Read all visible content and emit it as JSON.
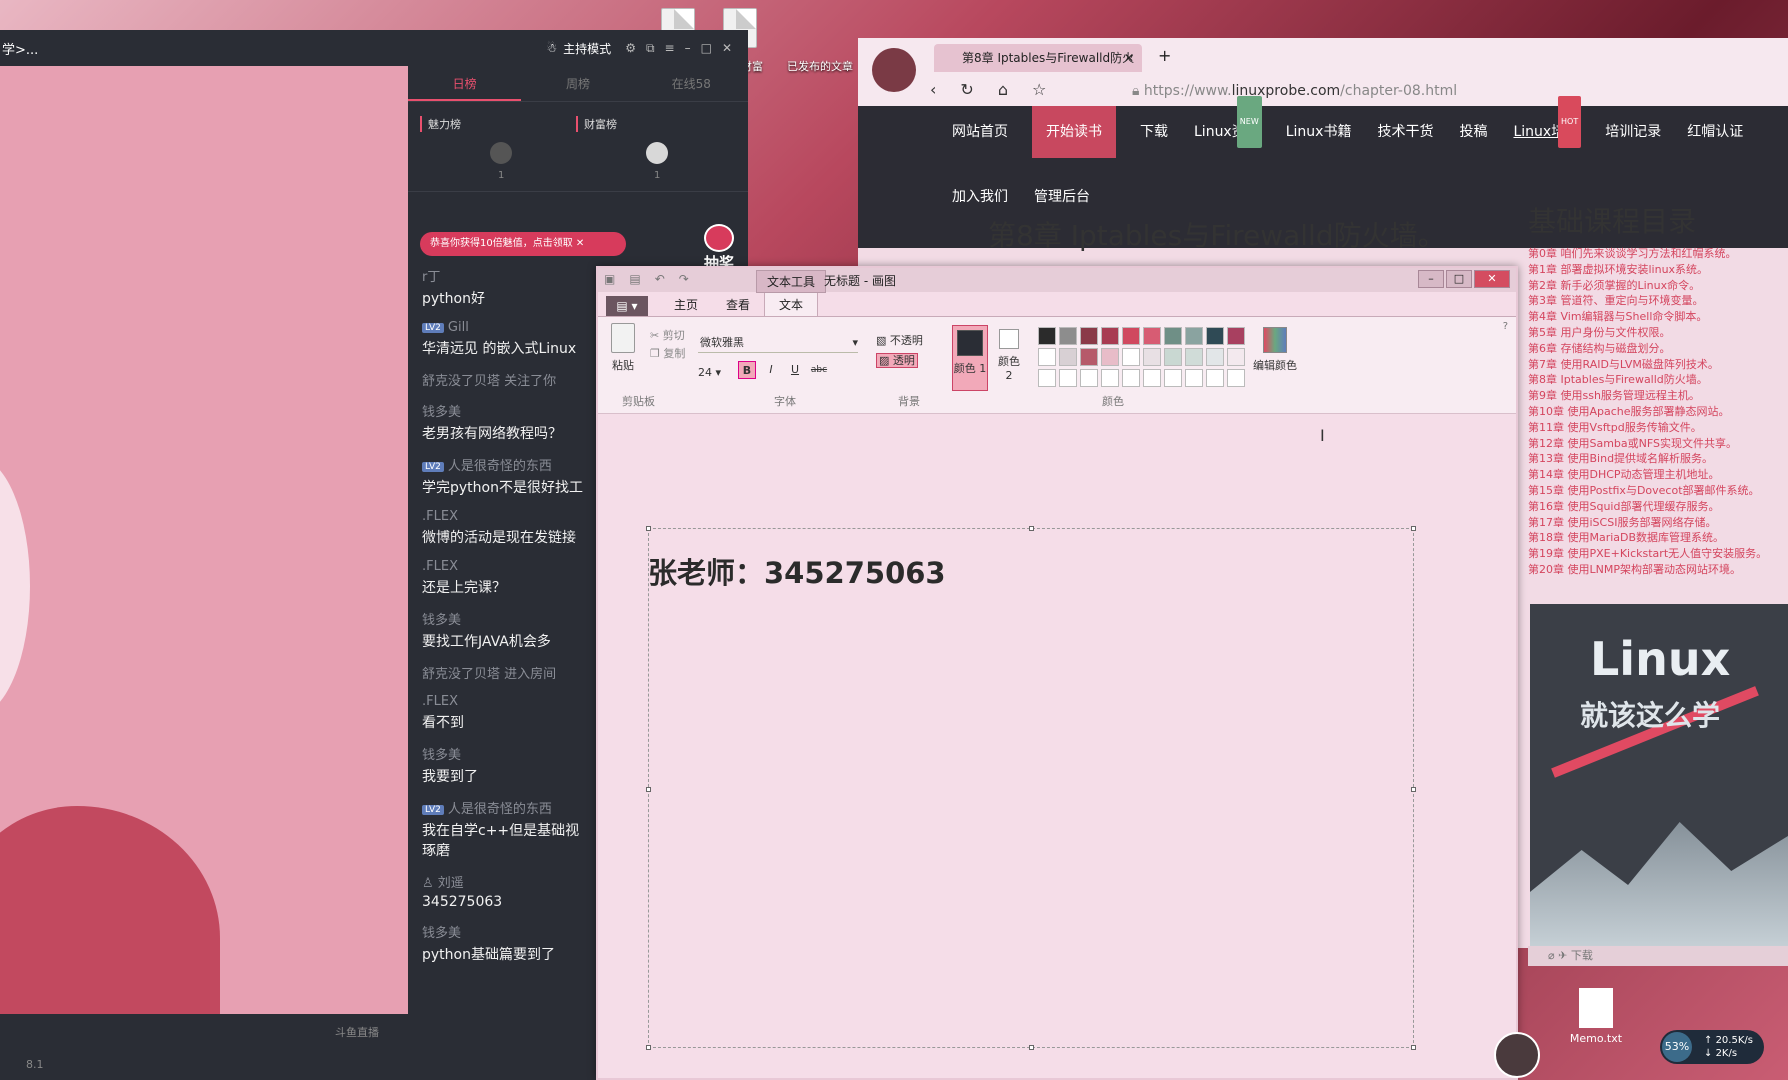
{
  "desktop": {
    "icons_top": [
      "财富",
      "已发布的文章"
    ],
    "memo_label": "Memo.txt"
  },
  "live": {
    "breadcrumb": "学>...",
    "mode_label": "主持模式",
    "tabs": [
      "日榜",
      "周榜",
      "在线58"
    ],
    "rank_charm": "魅力榜",
    "rank_wealth": "财富榜",
    "rank_count_1": "1",
    "rank_count_2": "1",
    "gift_banner": "恭喜你获得10倍魅值，点击领取",
    "lottery": "抽奖",
    "footer_fps": "8.1",
    "footer_tag": "斗鱼直播",
    "messages": [
      {
        "user": "r丁",
        "text": "python好",
        "lv": ""
      },
      {
        "user": "Gill",
        "text": "华清远见 的嵌入式Linux",
        "lv": "LV2"
      },
      {
        "sys": "舒克没了贝塔 关注了你"
      },
      {
        "user": "钱多美",
        "text": "老男孩有网络教程吗？",
        "lv": ""
      },
      {
        "user": "人是很奇怪的东西",
        "text": "学完python不是很好找工",
        "lv": "LV2"
      },
      {
        "user": ".FLEX",
        "text": "微博的活动是现在发链接",
        "lv": ""
      },
      {
        "user": ".FLEX",
        "text": "还是上完课？",
        "lv": ""
      },
      {
        "user": "钱多美",
        "text": "要找工作JAVA机会多",
        "lv": ""
      },
      {
        "sys": "舒克没了贝塔 进入房间"
      },
      {
        "user": ".FLEX",
        "text": "看不到",
        "lv": ""
      },
      {
        "user": "钱多美",
        "text": "我要到了",
        "lv": ""
      },
      {
        "user": "人是很奇怪的东西",
        "text": "我在自学c++但是基础视",
        "text2": "琢磨",
        "lv": "LV2"
      },
      {
        "user": "刘遥",
        "text": "345275063",
        "lv": ""
      },
      {
        "user": "钱多美",
        "text": "python基础篇要到了",
        "lv": ""
      }
    ]
  },
  "browser": {
    "tab_title": "第8章 Iptables与Firewalld防火",
    "url_prefix": "https://www.",
    "url_domain": "linuxprobe.com",
    "url_path": "/chapter-08.html",
    "menu_row1": [
      "网站首页",
      "开始读书",
      "下载",
      "Linux资讯",
      "Linux书籍",
      "技术干货",
      "投稿",
      "Linux培训",
      "培训记录",
      "红帽认证"
    ],
    "menu_row2": [
      "加入我们",
      "管理后台"
    ],
    "badge_new": "NEW",
    "badge_hot": "HOT",
    "page_title": "第8章 Iptables与Firewalld防火墙。",
    "toc_title": "基础课程目录",
    "toc": [
      "第0章 咱们先来谈谈学习方法和红帽系统。",
      "第1章 部署虚拟环境安装linux系统。",
      "第2章 新手必须掌握的Linux命令。",
      "第3章 管道符、重定向与环境变量。",
      "第4章 Vim编辑器与Shell命令脚本。",
      "第5章 用户身份与文件权限。",
      "第6章 存储结构与磁盘划分。",
      "第7章 使用RAID与LVM磁盘阵列技术。",
      "第8章 Iptables与Firewalld防火墙。",
      "第9章 使用ssh服务管理远程主机。",
      "第10章 使用Apache服务部署静态网站。",
      "第11章 使用Vsftpd服务传输文件。",
      "第12章 使用Samba或NFS实现文件共享。",
      "第13章 使用Bind提供域名解析服务。",
      "第14章 使用DHCP动态管理主机地址。",
      "第15章 使用Postfix与Dovecot部署邮件系统。",
      "第16章 使用Squid部署代理缓存服务。",
      "第17章 使用iSCSI服务部署网络存储。",
      "第18章 使用MariaDB数据库管理系统。",
      "第19章 使用PXE+Kickstart无人值守安装服务。",
      "第20章 使用LNMP架构部署动态网站环境。"
    ],
    "book_title": "Linux",
    "book_subtitle": "就该这么学",
    "bottom_bar": "下载"
  },
  "paint": {
    "context_tab": "文本工具",
    "window_name": "无标题 - 画图",
    "tabs": [
      "主页",
      "查看",
      "文本"
    ],
    "active_tab": "文本",
    "paste": "粘贴",
    "cut": "剪切",
    "copy": "复制",
    "font_name": "微软雅黑",
    "font_size": "24",
    "opaque": "不透明",
    "transparent": "透明",
    "color1": "颜色 1",
    "color2": "颜色 2",
    "edit_colors": "编辑颜色",
    "group_clipboard": "剪贴板",
    "group_font": "字体",
    "group_bg": "背景",
    "group_colors": "颜色",
    "canvas_text": "张老师：345275063",
    "palette": [
      "#2b2b2b",
      "#8d8d8d",
      "#8a3a48",
      "#a83b52",
      "#d0485f",
      "#d75c73",
      "#6f8f86",
      "#8aa3a0",
      "#2f4a55",
      "#a84060",
      "#ffffff",
      "#d8d0d4",
      "#b65a6a",
      "#e8bcc8",
      "#ffffff",
      "#e8e0e4",
      "#c9d8d2",
      "#d0dcd8",
      "#e2e6e8",
      "#f3e9ee",
      "#ffffff",
      "#ffffff",
      "#ffffff",
      "#ffffff",
      "#ffffff",
      "#ffffff",
      "#ffffff",
      "#ffffff",
      "#ffffff",
      "#ffffff"
    ]
  },
  "tray": {
    "cpu_pct": "53%",
    "up": "20.5K/s",
    "down": "2K/s"
  }
}
